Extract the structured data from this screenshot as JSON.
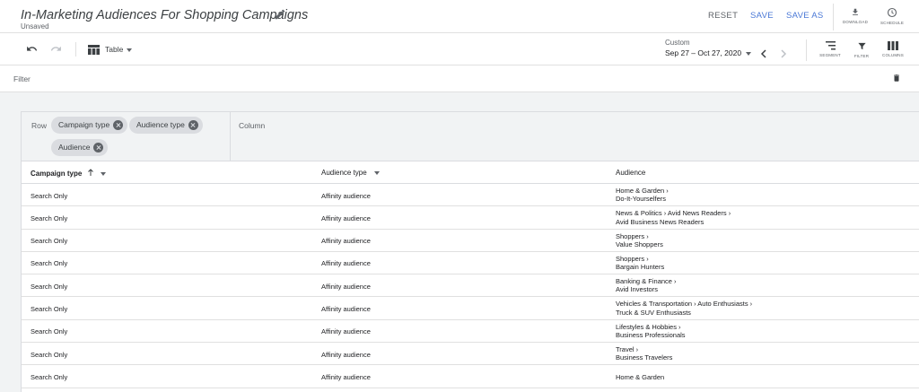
{
  "header": {
    "title": "In-Marketing Audiences For Shopping Campaigns",
    "status": "Unsaved",
    "reset_label": "RESET",
    "save_label": "SAVE",
    "save_as_label": "SAVE AS",
    "download_label": "DOWNLOAD",
    "schedule_label": "SCHEDULE",
    "accent_color": "#4a78d6"
  },
  "toolbar": {
    "view_label": "Table",
    "date_caption": "Custom",
    "date_range": "Sep 27 – Oct 27, 2020",
    "segment_label": "SEGMENT",
    "filter_label": "FILTER",
    "columns_label": "COLUMNS"
  },
  "filterbar": {
    "label": "Filter"
  },
  "pivot": {
    "row_label": "Row",
    "column_label": "Column",
    "row_chips": [
      "Campaign type",
      "Audience type",
      "Audience"
    ]
  },
  "table": {
    "headers": [
      "Campaign type",
      "Audience type",
      "Audience"
    ],
    "rows": [
      {
        "campaign_type": "Search Only",
        "audience_type": "Affinity audience",
        "audience": [
          "Home & Garden ›",
          "Do-It-Yourselfers"
        ]
      },
      {
        "campaign_type": "Search Only",
        "audience_type": "Affinity audience",
        "audience": [
          "News & Politics › Avid News Readers ›",
          "Avid Business News Readers"
        ]
      },
      {
        "campaign_type": "Search Only",
        "audience_type": "Affinity audience",
        "audience": [
          "Shoppers ›",
          "Value Shoppers"
        ]
      },
      {
        "campaign_type": "Search Only",
        "audience_type": "Affinity audience",
        "audience": [
          "Shoppers ›",
          "Bargain Hunters"
        ]
      },
      {
        "campaign_type": "Search Only",
        "audience_type": "Affinity audience",
        "audience": [
          "Banking & Finance ›",
          "Avid Investors"
        ]
      },
      {
        "campaign_type": "Search Only",
        "audience_type": "Affinity audience",
        "audience": [
          "Vehicles & Transportation › Auto Enthusiasts ›",
          "Truck & SUV Enthusiasts"
        ]
      },
      {
        "campaign_type": "Search Only",
        "audience_type": "Affinity audience",
        "audience": [
          "Lifestyles & Hobbies ›",
          "Business Professionals"
        ]
      },
      {
        "campaign_type": "Search Only",
        "audience_type": "Affinity audience",
        "audience": [
          "Travel ›",
          "Business Travelers"
        ]
      },
      {
        "campaign_type": "Search Only",
        "audience_type": "Affinity audience",
        "audience": [
          "Home & Garden"
        ]
      }
    ]
  }
}
